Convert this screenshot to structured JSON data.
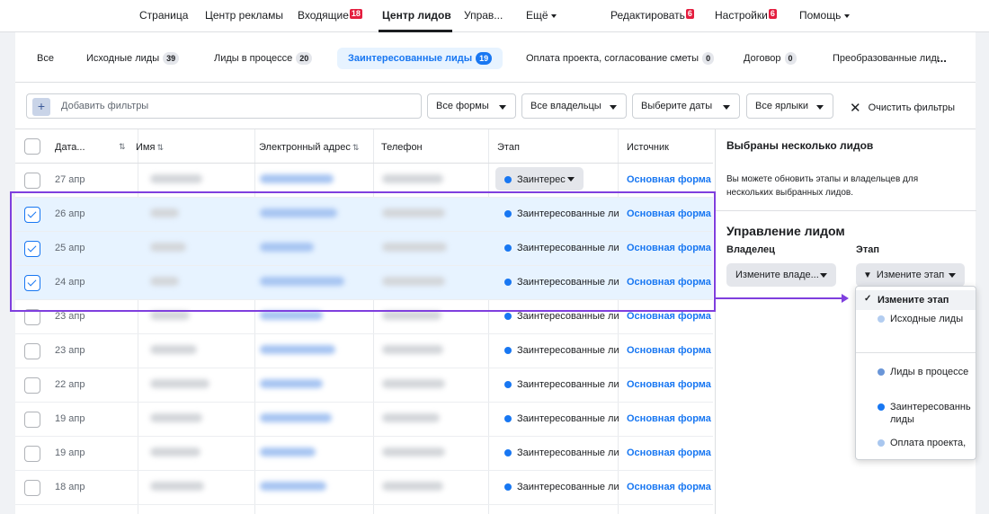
{
  "topnav": {
    "items": [
      "Страница",
      "Центр рекламы",
      "Входящие",
      "Центр лидов",
      "Управ...",
      "Ещё",
      "Редактировать",
      "Настройки",
      "Помощь"
    ],
    "inbox_badge": "18",
    "edit_badge": "6",
    "settings_badge": "6"
  },
  "tabs": [
    {
      "label": "Все",
      "count": ""
    },
    {
      "label": "Исходные лиды",
      "count": "39"
    },
    {
      "label": "Лиды в процессе",
      "count": "20"
    },
    {
      "label": "Заинтересованные лиды",
      "count": "19"
    },
    {
      "label": "Оплата проекта, согласование сметы",
      "count": "0"
    },
    {
      "label": "Договор",
      "count": "0"
    },
    {
      "label": "Преобразованные лиды",
      "count": ""
    }
  ],
  "more_label": "...",
  "filters": {
    "add_placeholder": "Добавить фильтры",
    "plus": "+",
    "forms": "Все формы",
    "owners": "Все владельцы",
    "dates": "Выберите даты",
    "labels": "Все ярлыки",
    "clear": "Очистить фильтры"
  },
  "table": {
    "headers": {
      "date": "Дата...",
      "name": "Имя",
      "email": "Электронный адрес",
      "phone": "Телефон",
      "stage": "Этап",
      "source": "Источник"
    },
    "sort_glyph": "⇅",
    "rows": [
      {
        "date": "27 апр",
        "checked": false,
        "stage": "Заинтерес",
        "stage_dropdown": true,
        "source": "Основная форма"
      },
      {
        "date": "26 апр",
        "checked": true,
        "stage": "Заинтересованные ли",
        "source": "Основная форма"
      },
      {
        "date": "25 апр",
        "checked": true,
        "stage": "Заинтересованные ли",
        "source": "Основная форма"
      },
      {
        "date": "24 апр",
        "checked": true,
        "stage": "Заинтересованные ли",
        "source": "Основная форма"
      },
      {
        "date": "23 апр",
        "checked": false,
        "stage": "Заинтересованные ли",
        "source": "Основная форма"
      },
      {
        "date": "23 апр",
        "checked": false,
        "stage": "Заинтересованные ли",
        "source": "Основная форма"
      },
      {
        "date": "22 апр",
        "checked": false,
        "stage": "Заинтересованные ли",
        "source": "Основная форма"
      },
      {
        "date": "19 апр",
        "checked": false,
        "stage": "Заинтересованные ли",
        "source": "Основная форма"
      },
      {
        "date": "19 апр",
        "checked": false,
        "stage": "Заинтересованные ли",
        "source": "Основная форма"
      },
      {
        "date": "18 апр",
        "checked": false,
        "stage": "Заинтересованные ли",
        "source": "Основная форма"
      }
    ]
  },
  "side": {
    "title": "Выбраны несколько лидов",
    "description": "Вы можете обновить этапы и владельцев для нескольких выбранных лидов.",
    "manage_title": "Управление лидом",
    "owner_label": "Владелец",
    "stage_label": "Этап",
    "owner_button": "Измените владе...",
    "stage_button": "Измените этап"
  },
  "stage_menu": {
    "checked_item": "Измените этап",
    "checkmark": "✓",
    "items": [
      {
        "label": "Исходные лиды",
        "color": "#b3cdf0"
      },
      {
        "label": "Лиды в процессе",
        "color": "#6a96d8"
      },
      {
        "label": "Заинтересованные лиды",
        "color": "#1877f2"
      },
      {
        "label": "Оплата проекта,",
        "color": "#a9c7ef"
      }
    ]
  },
  "colors": {
    "accent": "#1877f2",
    "annotation": "#7f3fde",
    "selected_row": "#e7f3ff"
  }
}
